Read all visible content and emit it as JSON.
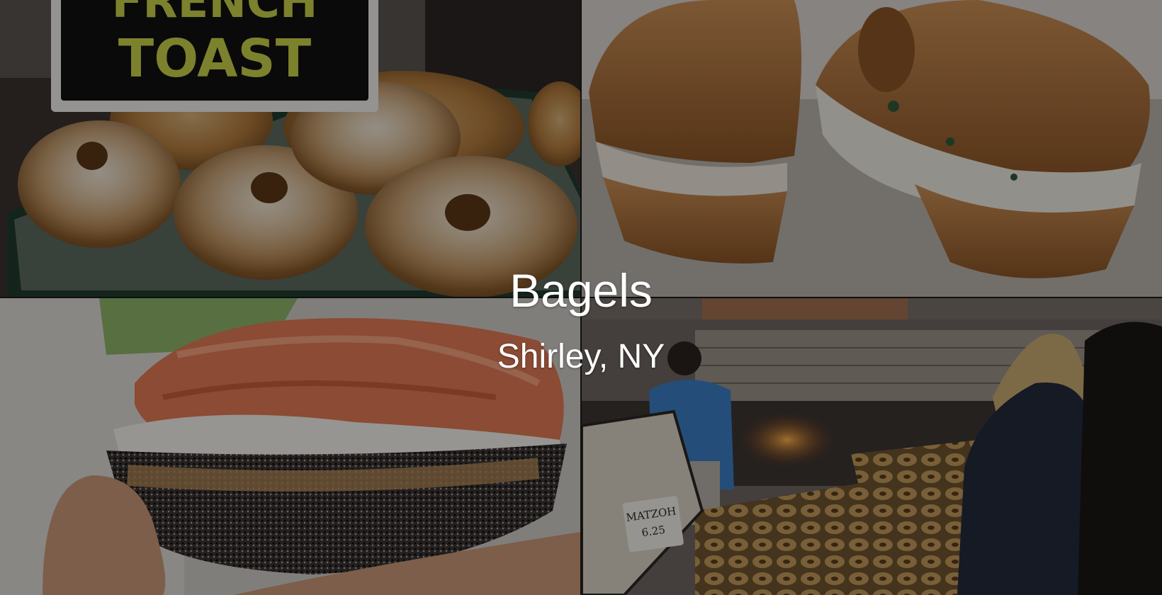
{
  "slide": {
    "title": "Bagels",
    "subtitle": "Shirley, NY"
  },
  "photos": {
    "top_left": {
      "sign_line_1": "FRENCH",
      "sign_line_2": "TOAST"
    },
    "bottom_right": {
      "bin_tag_label": "MATZOH",
      "bin_tag_price": "6.25"
    }
  },
  "colors": {
    "title_text": "#ffffff",
    "overlay": "rgba(0,0,0,0.38)",
    "sign_text": "#c9d14a",
    "sign_background": "#111111"
  }
}
